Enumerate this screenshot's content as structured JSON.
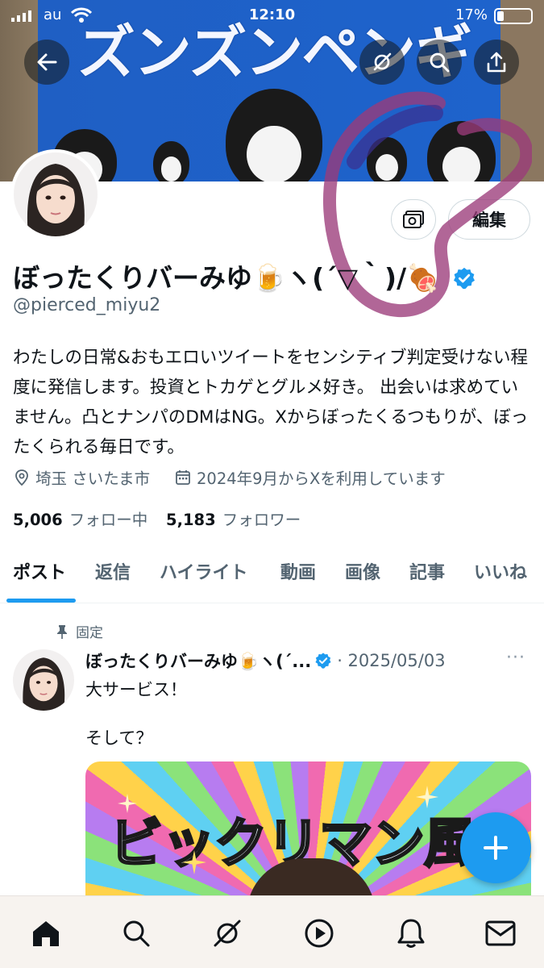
{
  "status_bar": {
    "carrier": "au",
    "time": "12:10",
    "battery": "17%"
  },
  "banner": {
    "title": "ズンズンペンギン"
  },
  "profile": {
    "name": "ぼったくりバーみゆ🍺ヽ(´▽｀)/🍖",
    "handle": "@pierced_miyu2",
    "edit_label": "編集",
    "bio": "わたしの日常&おもエロいツイートをセンシティブ判定受けない程度に発信します。投資とトカゲとグルメ好き。 出会いは求めていません。凸とナンパのDMはNG。Xからぼったくるつもりが、ぼったくられる毎日です。",
    "location": "埼玉 さいたま市",
    "joined": "2024年9月からXを利用しています",
    "following_count": "5,006",
    "following_label": "フォロー中",
    "followers_count": "5,183",
    "followers_label": "フォロワー"
  },
  "tabs": [
    {
      "label": "ポスト"
    },
    {
      "label": "返信"
    },
    {
      "label": "ハイライト"
    },
    {
      "label": "動画"
    },
    {
      "label": "画像"
    },
    {
      "label": "記事"
    },
    {
      "label": "いいね"
    }
  ],
  "post": {
    "pinned_label": "固定",
    "author": "ぼったくりバーみゆ🍺ヽ(´...",
    "date": "· 2025/05/03",
    "more": "···",
    "text": "大サービス！\n\nそして？",
    "media_title": "ビックリマン風"
  },
  "colors": {
    "accent": "#1d9bf0",
    "text": "#0f1419",
    "secondary": "#536471"
  }
}
